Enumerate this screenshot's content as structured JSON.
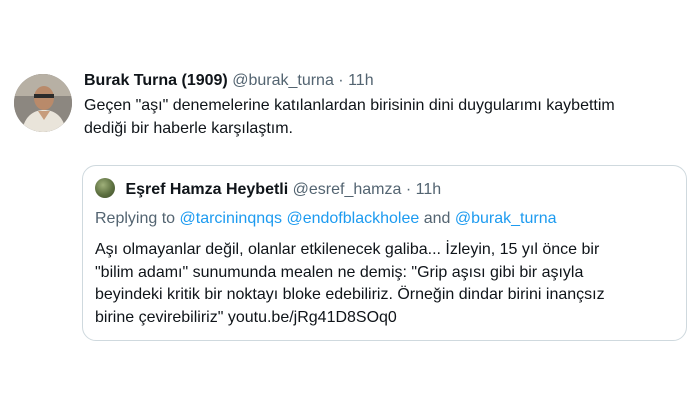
{
  "tweet": {
    "name": "Burak Turna (1909)",
    "handle": "@burak_turna",
    "separator": "·",
    "time": "11h",
    "text": "Geçen \"aşı\" denemelerine katılanlardan birisinin dini duygularımı kaybettim\ndediği bir haberle karşılaştım."
  },
  "quote": {
    "name": "Eşref Hamza Heybetli",
    "handle": "@esref_hamza",
    "separator": "·",
    "time": "11h",
    "replying_prefix": "Replying to",
    "mentions": [
      "@tarcininqnqs",
      "@endofblackholee"
    ],
    "and_word": "and",
    "last_mention": "@burak_turna",
    "text": "Aşı olmayanlar değil, olanlar etkilenecek galiba... İzleyin, 15 yıl önce bir\n\"bilim adamı\" sunumunda mealen ne demiş: \"Grip aşısı gibi bir aşıyla\nbeyindeki kritik bir noktayı bloke edebiliriz. Örneğin dindar birini inançsız\nbirine çevirebiliriz\" youtu.be/jRg41D8SOq0"
  },
  "colors": {
    "text": "#0f1419",
    "secondary": "#536471",
    "link": "#1d9bf0",
    "border": "#cfd9de"
  }
}
